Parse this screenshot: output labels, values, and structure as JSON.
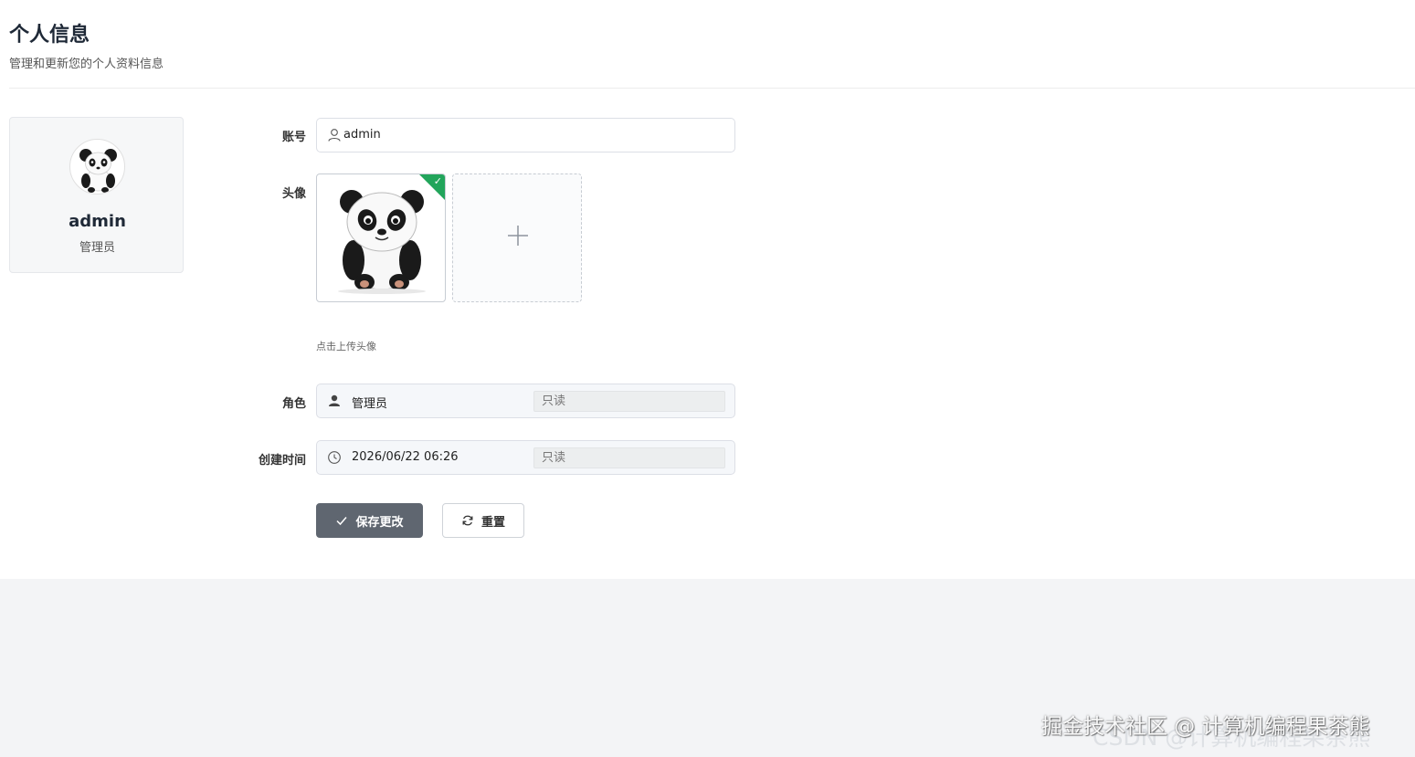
{
  "header": {
    "title": "个人信息",
    "subtitle": "管理和更新您的个人资料信息"
  },
  "profile_card": {
    "name": "admin",
    "role": "管理员",
    "avatar_icon": "panda-avatar-icon"
  },
  "form": {
    "account": {
      "label": "账号",
      "value": "admin",
      "icon": "user-outline-icon"
    },
    "avatar": {
      "label": "头像",
      "hint": "点击上传头像",
      "upload_icon": "plus-icon"
    },
    "role": {
      "label": "角色",
      "value": "管理员",
      "readonly_tag": "只读",
      "icon": "user-solid-icon"
    },
    "created": {
      "label": "创建时间",
      "value": "2026/06/22 06:26",
      "readonly_tag": "只读",
      "icon": "clock-icon"
    }
  },
  "buttons": {
    "save_label": "保存更改",
    "reset_label": "重置"
  },
  "watermark": {
    "main": "掘金技术社区 @ 计算机编程果茶熊",
    "faint": "CSDN @计算机编程果茶熊"
  },
  "colors": {
    "save_button": "#5f6670",
    "check_badge": "#22a55b"
  }
}
